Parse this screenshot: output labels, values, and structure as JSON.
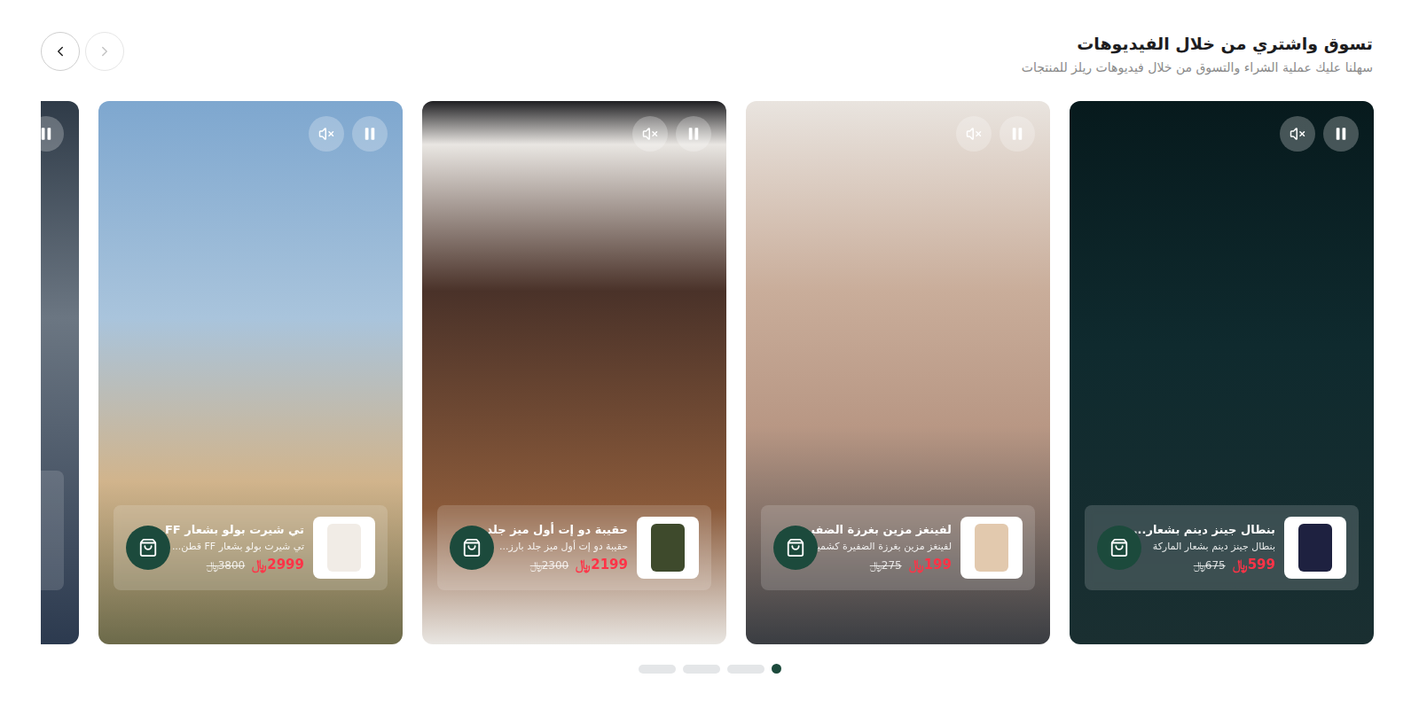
{
  "section": {
    "title": "تسوق واشتري من خلال الفيديوهات",
    "subtitle": "سهلنا عليك عملية الشراء والتسوق من خلال فيديوهات ريلز للمنتجات"
  },
  "nav": {
    "prev_disabled": true,
    "next_disabled": false
  },
  "currency": "﷼",
  "cards": [
    {
      "playing": true,
      "muted": true,
      "title": "بنطال جينز دينم بشعار...",
      "description": "بنطال جينز دينم بشعار الماركة",
      "price": "599",
      "old_price": "675"
    },
    {
      "playing": true,
      "muted": true,
      "title": "لفينغز مزين بغرزة الضفيرة...",
      "description": "لفينغز مزين بغرزة الضفيرة كشمير",
      "price": "199",
      "old_price": "275"
    },
    {
      "playing": true,
      "muted": true,
      "title": "حقيبة دو إت أول ميز جلد...",
      "description": "حقيبة دو إت أول ميز جلد بارز...",
      "price": "2199",
      "old_price": "2300"
    },
    {
      "playing": true,
      "muted": true,
      "title": "تي شيرت بولو بشعار FF...",
      "description": "تي شيرت بولو بشعار FF قطن...",
      "price": "2999",
      "old_price": "3800"
    }
  ],
  "partial_card": {
    "playing": true
  },
  "pagination": [
    {
      "selected": true
    },
    {
      "selected": false
    },
    {
      "selected": false
    },
    {
      "selected": false
    }
  ]
}
